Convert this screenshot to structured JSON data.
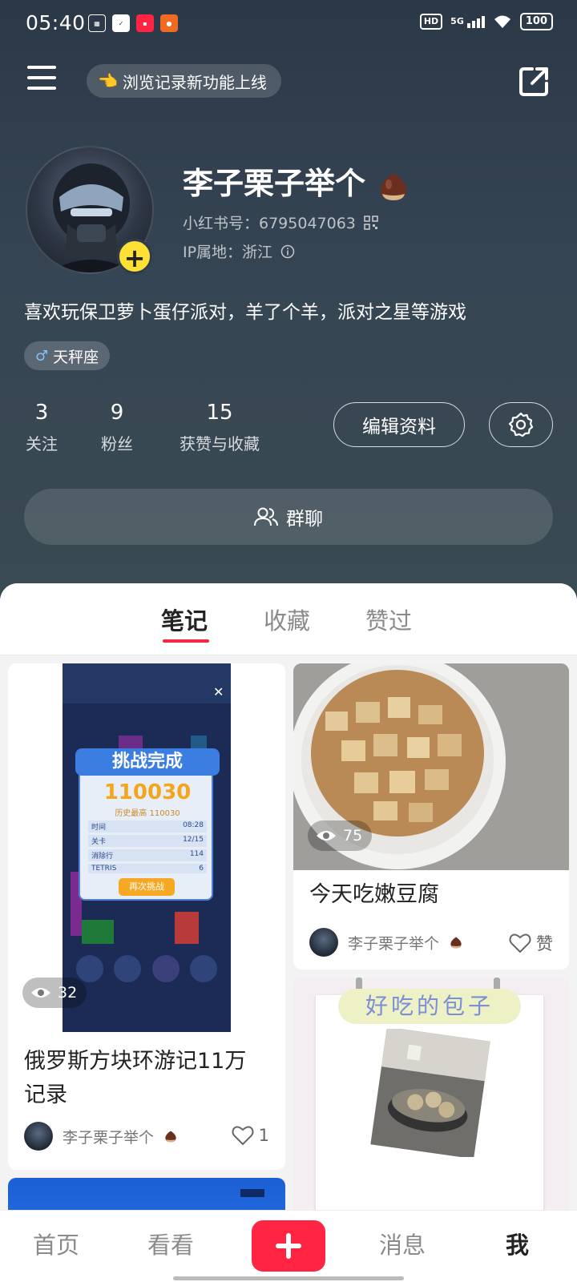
{
  "status_bar": {
    "time": "05:40",
    "hd": "HD",
    "network": "5G",
    "battery": "100",
    "icons": [
      "news-icon",
      "clipboard-icon",
      "app-icon",
      "fruit-icon"
    ]
  },
  "top_bar": {
    "notice": "浏览记录新功能上线",
    "notice_emoji": "👈"
  },
  "profile": {
    "nickname": "李子栗子举个",
    "redbook_id": "小红书号：6795047063",
    "ip_location": "IP属地：浙江",
    "bio": "喜欢玩保卫萝卜蛋仔派对，羊了个羊，派对之星等游戏",
    "zodiac": "天秤座",
    "stats": [
      {
        "num": "3",
        "label": "关注"
      },
      {
        "num": "9",
        "label": "粉丝"
      },
      {
        "num": "15",
        "label": "获赞与收藏"
      }
    ],
    "edit_label": "编辑资料",
    "group_chat_label": "群聊"
  },
  "tabs": {
    "notes": "笔记",
    "collections": "收藏",
    "liked": "赞过"
  },
  "cards": [
    {
      "title": "俄罗斯方块环游记11万记录",
      "title_line1": "俄罗斯方块环游记11万",
      "title_line2": "记录",
      "views": "32",
      "author": "李子栗子举个",
      "likes": "1",
      "game_panel": {
        "heading": "挑战完成",
        "score": "110030",
        "best": "历史最高 110030",
        "rows": [
          {
            "k": "时间",
            "v": "08:28"
          },
          {
            "k": "关卡",
            "v": "12/15"
          },
          {
            "k": "消除行",
            "v": "114"
          },
          {
            "k": "TETRIS",
            "v": "6"
          }
        ],
        "retry": "再次挑战"
      }
    },
    {
      "title": "今天吃嫩豆腐",
      "views": "75",
      "author": "李子栗子举个",
      "likes": "赞"
    },
    {
      "handwriting": "好吃的包子"
    }
  ],
  "bottom_nav": {
    "home": "首页",
    "watch": "看看",
    "messages": "消息",
    "me": "我"
  }
}
